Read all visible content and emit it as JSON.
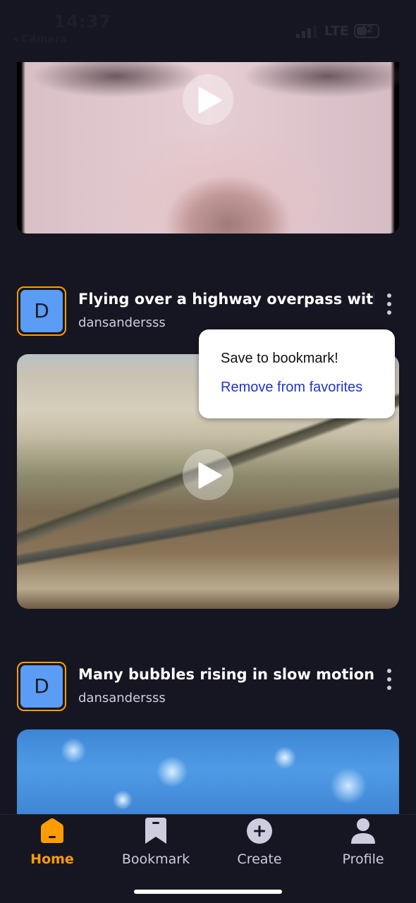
{
  "status_bar": {
    "time": "14:37",
    "back_app": "◂ Cámara",
    "network": "LTE",
    "battery": "42"
  },
  "posts": [
    {
      "avatar_letter": "D",
      "title": "Flying over a highway overpass with...",
      "author": "dansandersss"
    },
    {
      "avatar_letter": "D",
      "title": "Many bubbles rising in slow motion i...",
      "author": "dansandersss"
    }
  ],
  "popup_menu": {
    "save_label": "Save to bookmark!",
    "remove_label": "Remove from favorites"
  },
  "tabs": [
    {
      "label": "Home",
      "icon": "home-icon",
      "active": true
    },
    {
      "label": "Bookmark",
      "icon": "bookmark-icon",
      "active": false
    },
    {
      "label": "Create",
      "icon": "plus-circle-icon",
      "active": false
    },
    {
      "label": "Profile",
      "icon": "person-icon",
      "active": false
    }
  ],
  "colors": {
    "background": "#161622",
    "accent": "#ff9c01",
    "avatar_bg": "#5b9cf5",
    "text_secondary": "#cdcde0",
    "link_blue": "#1f33d0"
  }
}
